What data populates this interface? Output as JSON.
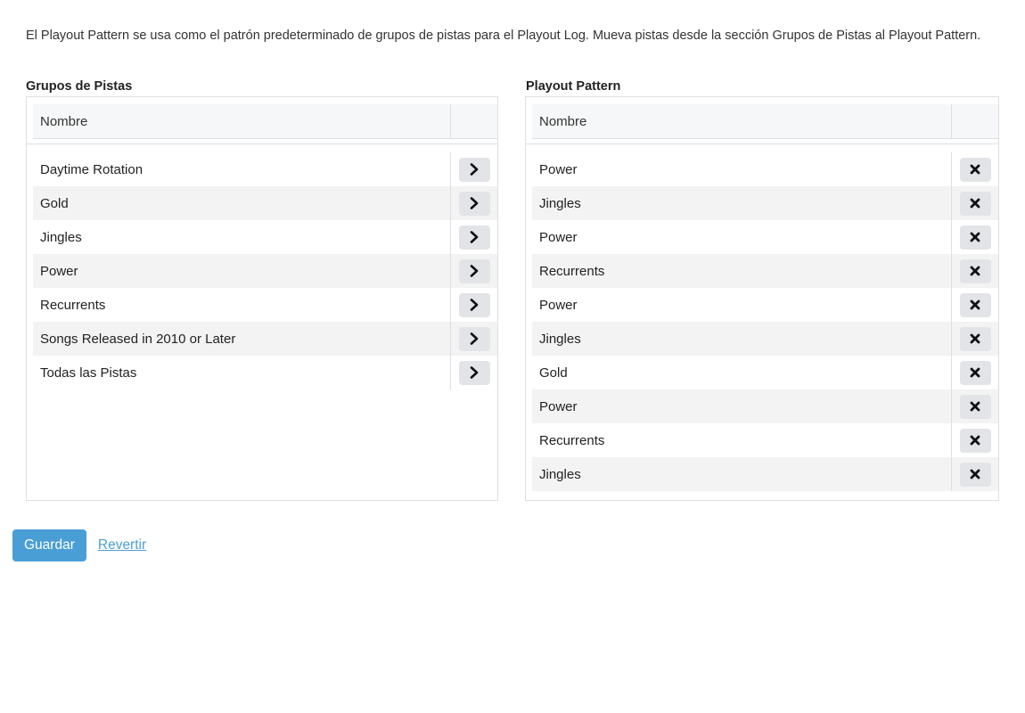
{
  "intro_text": "El Playout Pattern se usa como el patrón predeterminado de grupos de pistas para el Playout Log. Mueva pistas desde la sección Grupos de Pistas al Playout Pattern.",
  "left_panel": {
    "title": "Grupos de Pistas",
    "column_header": "Nombre",
    "rows": [
      "Daytime Rotation",
      "Gold",
      "Jingles",
      "Power",
      "Recurrents",
      "Songs Released in 2010 or Later",
      "Todas las Pistas"
    ],
    "row_action_icon": "chevron-right-icon"
  },
  "right_panel": {
    "title": "Playout Pattern",
    "column_header": "Nombre",
    "rows": [
      "Power",
      "Jingles",
      "Power",
      "Recurrents",
      "Power",
      "Jingles",
      "Gold",
      "Power",
      "Recurrents",
      "Jingles"
    ],
    "row_action_icon": "remove-x-icon"
  },
  "actions": {
    "save_label": "Guardar",
    "revert_label": "Revertir"
  },
  "colors": {
    "primary": "#4a9ed6",
    "row_stripe": "#f3f3f3",
    "action_button_bg": "#e2e4e7"
  }
}
